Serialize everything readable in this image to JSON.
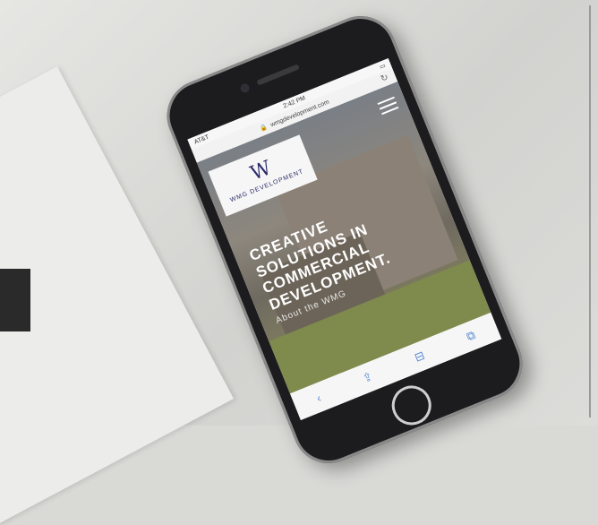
{
  "status_bar": {
    "carrier": "AT&T",
    "time": "2:42 PM"
  },
  "browser": {
    "url": "wmgdevelopment.com"
  },
  "site": {
    "logo_mark": "W",
    "logo_text": "WMG DEVELOPMENT",
    "headline_lines": [
      "CREATIVE",
      "SOLUTIONS IN",
      "COMMERCIAL",
      "DEVELOPMENT."
    ],
    "sub_link": "About the WMG"
  },
  "icons": [
    "reload-icon",
    "hamburger-menu-icon",
    "back-icon",
    "share-icon",
    "bookmarks-icon",
    "tabs-icon",
    "lock-icon"
  ]
}
